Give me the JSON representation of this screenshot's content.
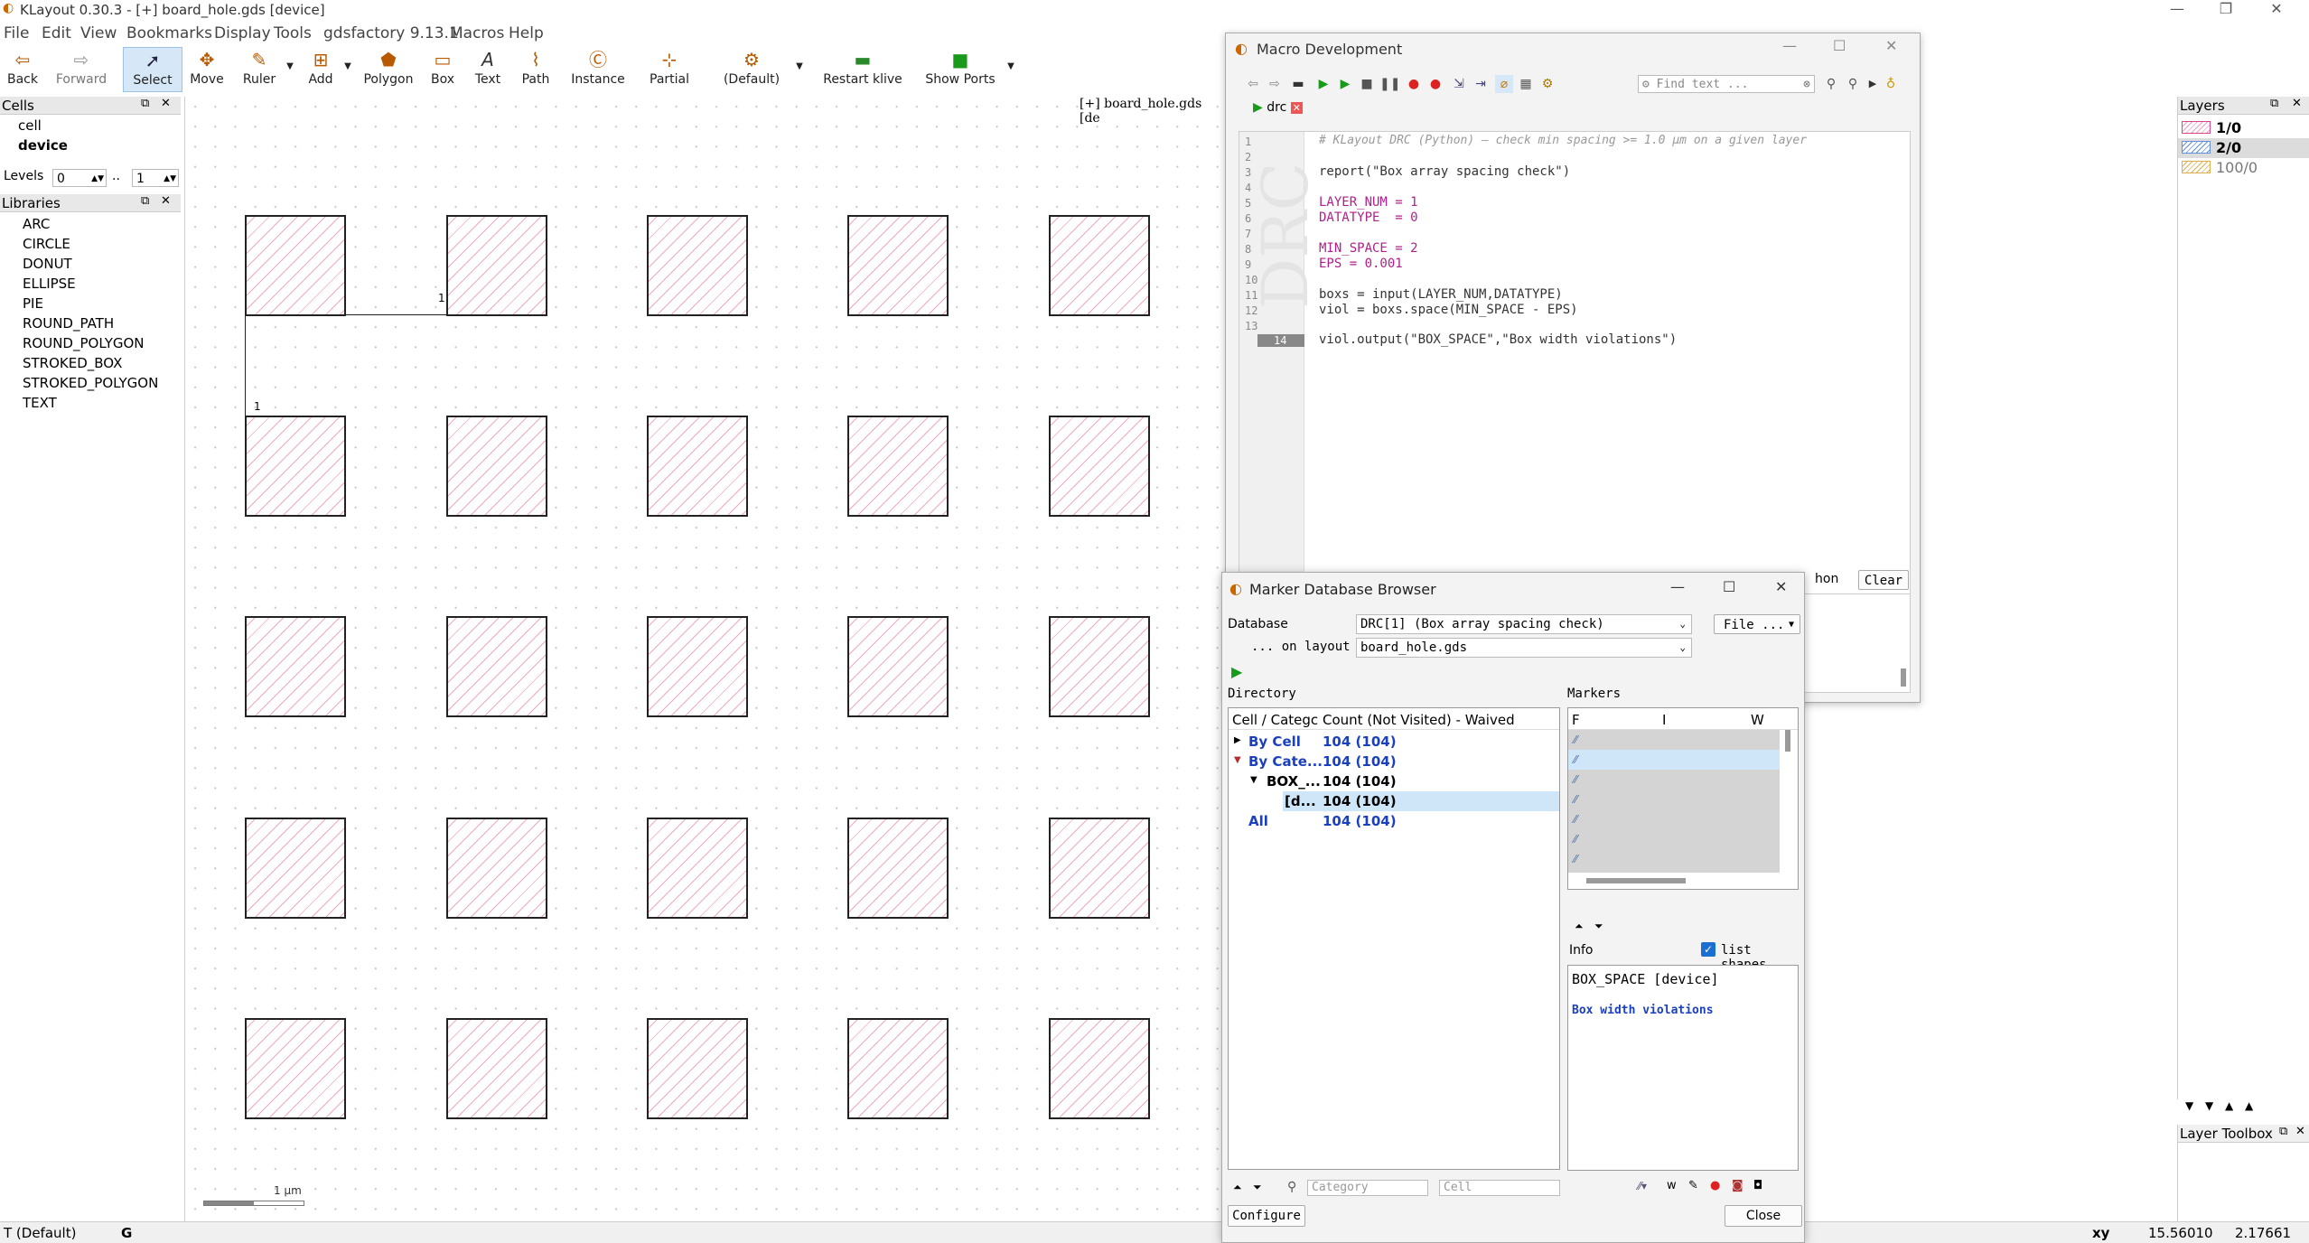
{
  "app": {
    "title": "KLayout 0.30.3 - [+] board_hole.gds [device]"
  },
  "menu": [
    "File",
    "Edit",
    "View",
    "Bookmarks",
    "Display",
    "Tools",
    "gdsfactory 9.13.1",
    "Macros",
    "Help"
  ],
  "toolbar": {
    "back": "Back",
    "forward": "Forward",
    "select": "Select",
    "move": "Move",
    "ruler": "Ruler",
    "add": "Add",
    "polygon": "Polygon",
    "box": "Box",
    "text": "Text",
    "path": "Path",
    "instance": "Instance",
    "partial": "Partial",
    "default": "(Default)",
    "restart": "Restart klive",
    "show_ports": "Show Ports"
  },
  "cells": {
    "title": "Cells",
    "items": [
      "cell",
      "device"
    ],
    "levels_label": "Levels",
    "level_from": "0",
    "level_to": "1",
    "level_sep": ".."
  },
  "libraries": {
    "title": "Libraries",
    "items": [
      "ARC",
      "CIRCLE",
      "DONUT",
      "ELLIPSE",
      "PIE",
      "ROUND_PATH",
      "ROUND_POLYGON",
      "STROKED_BOX",
      "STROKED_POLYGON",
      "TEXT"
    ]
  },
  "canvas": {
    "tab": "[+] board_hole.gds [de",
    "ruler_label_h": "1",
    "ruler_label_v": "1",
    "scale_label": "1 µm"
  },
  "layers": {
    "title": "Layers",
    "items": [
      {
        "name": "1/0",
        "color": "#f0a0c0"
      },
      {
        "name": "2/0",
        "color": "#6090e0"
      },
      {
        "name": "100/0",
        "color": "#e0b050"
      }
    ]
  },
  "layer_toolbox": {
    "title": "Layer Toolbox"
  },
  "status": {
    "mode": "T (Default)",
    "g": "G",
    "xy_label": "xy",
    "x": "15.56010",
    "y": "2.17661"
  },
  "macro": {
    "title": "Macro Development",
    "find_placeholder": "Find text ...",
    "tab": "drc",
    "watermark": "DRC",
    "console_clear": "Clear",
    "console_python": "hon",
    "lines": [
      {
        "n": "1",
        "text": "# KLayout DRC (Python) — check min spacing >= 1.0 µm on a given layer"
      },
      {
        "n": "2",
        "text": ""
      },
      {
        "n": "3",
        "text": "report(\"Box array spacing check\")"
      },
      {
        "n": "4",
        "text": ""
      },
      {
        "n": "5",
        "text": "LAYER_NUM = 1"
      },
      {
        "n": "6",
        "text": "DATATYPE  = 0"
      },
      {
        "n": "7",
        "text": ""
      },
      {
        "n": "8",
        "text": "MIN_SPACE = 2"
      },
      {
        "n": "9",
        "text": "EPS = 0.001"
      },
      {
        "n": "10",
        "text": ""
      },
      {
        "n": "11",
        "text": "boxs = input(LAYER_NUM,DATATYPE)"
      },
      {
        "n": "12",
        "text": "viol = boxs.space(MIN_SPACE - EPS)"
      },
      {
        "n": "13",
        "text": ""
      },
      {
        "n": "14",
        "text": "viol.output(\"BOX_SPACE\",\"Box width violations\")"
      }
    ]
  },
  "marker": {
    "title": "Marker Database Browser",
    "database_label": "Database",
    "database_value": "DRC[1] (Box array spacing check)",
    "layout_label": "... on layout",
    "layout_value": "board_hole.gds",
    "file_button": "File ...",
    "directory_label": "Directory",
    "markers_label": "Markers",
    "dir_headers": [
      "Cell / Categc",
      "Count (Not Visited) - Waived"
    ],
    "dir_rows": [
      {
        "name": "By Cell",
        "count": "104 (104)"
      },
      {
        "name": "By Cate...",
        "count": "104 (104)"
      },
      {
        "name": "BOX_...",
        "count": "104 (104)"
      },
      {
        "name": "[d...",
        "count": "104 (104)"
      },
      {
        "name": "All",
        "count": "104 (104)"
      }
    ],
    "marker_headers": [
      "F",
      "I",
      "W"
    ],
    "info_label": "Info",
    "list_shapes": "list shapes",
    "info_title": "BOX_SPACE [device]",
    "info_desc": "Box width violations",
    "category_placeholder": "Category",
    "cell_placeholder": "Cell",
    "configure": "Configure",
    "close": "Close"
  }
}
